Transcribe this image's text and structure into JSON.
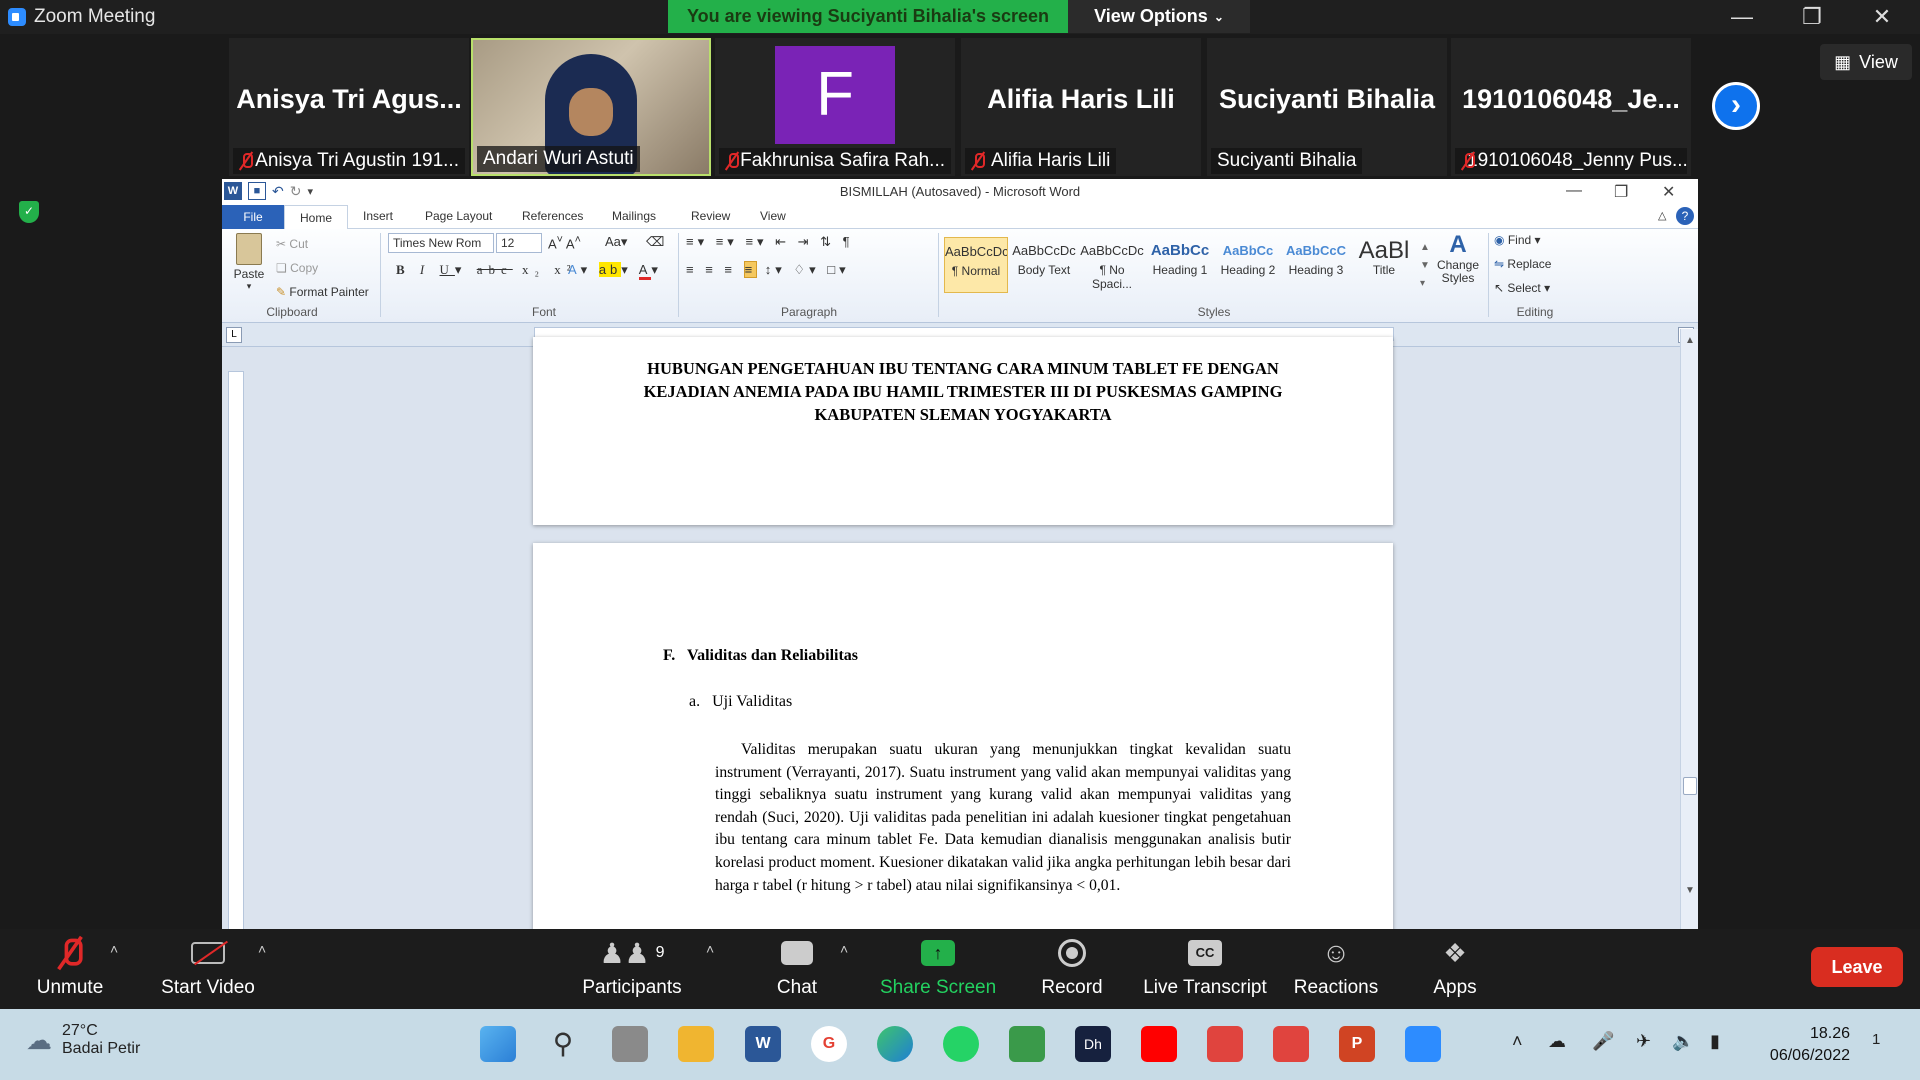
{
  "zoom": {
    "window_title": "Zoom Meeting",
    "viewing_banner": "You are viewing Suciyanti Bihalia's screen",
    "view_options": "View Options",
    "view_button": "View",
    "participants": [
      {
        "big_name": "Anisya Tri Agus...",
        "label": "Anisya Tri Agustin 191...",
        "muted": true
      },
      {
        "big_name": "",
        "label": "Andari Wuri Astuti",
        "muted": false,
        "video": true
      },
      {
        "big_name": "F",
        "label": "Fakhrunisa Safira Rah...",
        "muted": true,
        "avatar_color": "#7a23b6"
      },
      {
        "big_name": "Alifia Haris Lili",
        "label": "Alifia Haris Lili",
        "muted": true
      },
      {
        "big_name": "Suciyanti Bihalia",
        "label": "Suciyanti Bihalia",
        "muted": false
      },
      {
        "big_name": "1910106048_Je...",
        "label": "1910106048_Jenny Pus...",
        "muted": true
      }
    ],
    "toolbar": {
      "unmute": "Unmute",
      "start_video": "Start Video",
      "participants": "Participants",
      "participants_count": "9",
      "chat": "Chat",
      "share_screen": "Share Screen",
      "record": "Record",
      "live_transcript": "Live Transcript",
      "reactions": "Reactions",
      "apps": "Apps",
      "leave": "Leave"
    },
    "accent": "#23b04a"
  },
  "word": {
    "title": "BISMILLAH (Autosaved) - Microsoft Word",
    "tabs": [
      "File",
      "Home",
      "Insert",
      "Page Layout",
      "References",
      "Mailings",
      "Review",
      "View"
    ],
    "clipboard": {
      "paste": "Paste",
      "cut": "Cut",
      "copy": "Copy",
      "format_painter": "Format Painter",
      "label": "Clipboard"
    },
    "font": {
      "name": "Times New Rom",
      "size": "12",
      "label": "Font"
    },
    "paragraph_label": "Paragraph",
    "styles": [
      {
        "preview": "AaBbCcDc",
        "name": "¶ Normal"
      },
      {
        "preview": "AaBbCcDc",
        "name": "Body Text"
      },
      {
        "preview": "AaBbCcDc",
        "name": "¶ No Spaci..."
      },
      {
        "preview": "AaBbCc",
        "name": "Heading 1"
      },
      {
        "preview": "AaBbCc",
        "name": "Heading 2"
      },
      {
        "preview": "AaBbCcC",
        "name": "Heading 3"
      },
      {
        "preview": "AaBl",
        "name": "Title"
      }
    ],
    "styles_label": "Styles",
    "change_styles": "Change Styles",
    "editing": {
      "find": "Find",
      "replace": "Replace",
      "select": "Select",
      "label": "Editing"
    },
    "page1_title": "HUBUNGAN PENGETAHUAN IBU TENTANG CARA MINUM TABLET FE DENGAN KEJADIAN ANEMIA PADA IBU HAMIL TRIMESTER III DI PUSKESMAS GAMPING KABUPATEN SLEMAN YOGYAKARTA",
    "section_heading": "F.   Validitas dan Reliabilitas",
    "subheading": "a.   Uji Validitas",
    "paragraph": "Validitas merupakan suatu ukuran yang menunjukkan tingkat kevalidan suatu instrument (Verrayanti, 2017). Suatu instrument yang valid akan mempunyai validitas yang tinggi sebaliknya suatu instrument yang kurang valid akan mempunyai validitas yang rendah (Suci, 2020). Uji validitas pada penelitian ini adalah kuesioner tingkat pengetahuan ibu tentang cara minum tablet Fe. Data kemudian dianalisis menggunakan analisis butir korelasi product moment. Kuesioner dikatakan valid jika angka perhitungan lebih besar dari harga r tabel (r hitung > r tabel) atau nilai signifikansinya < 0,01."
  },
  "taskbar": {
    "temperature": "27°C",
    "weather": "Badai Petir",
    "time": "18.26",
    "date": "06/06/2022",
    "notifications": "1"
  }
}
